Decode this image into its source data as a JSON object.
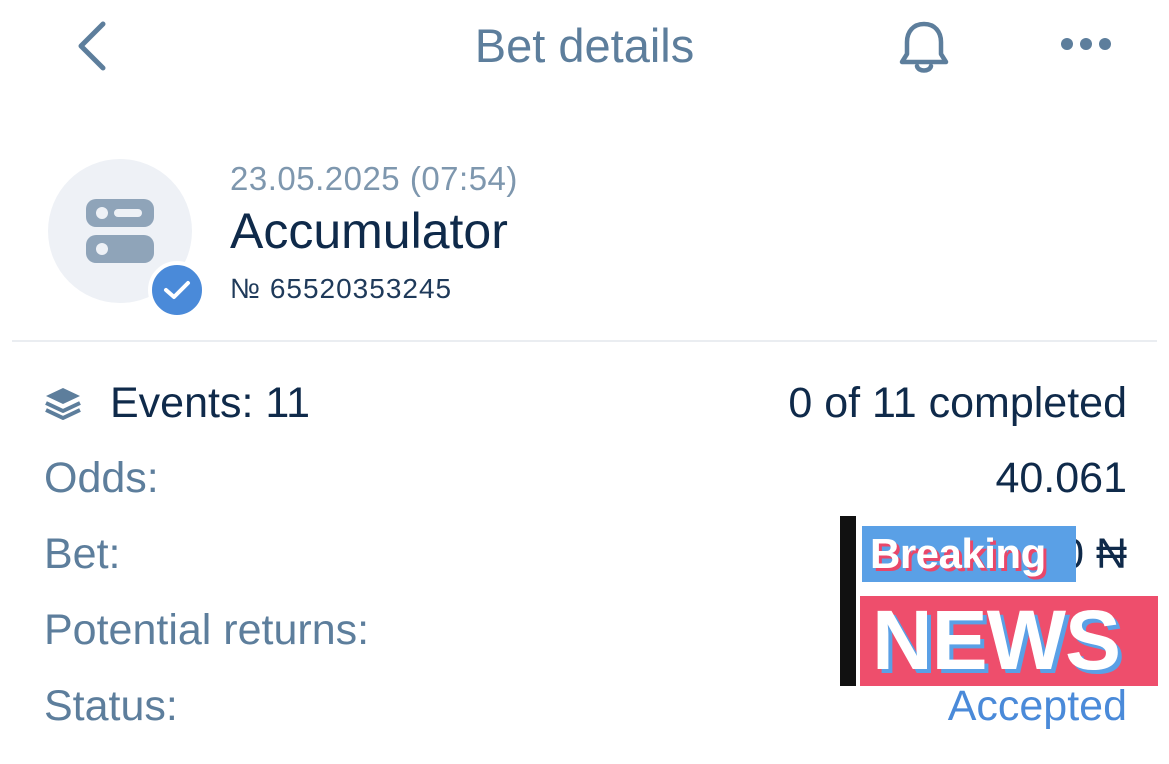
{
  "header": {
    "title": "Bet details",
    "back_icon": "chevron-left-icon",
    "bell_icon": "bell-icon",
    "more_icon": "more-horizontal-icon"
  },
  "bet": {
    "date": "23.05.2025 (07:54)",
    "type": "Accumulator",
    "number": "№ 65520353245",
    "type_icon": "accumulator-list-icon",
    "badge_icon": "checkmark-icon"
  },
  "details": {
    "events_label": "Events: 11",
    "events_icon": "stack-layers-icon",
    "completed": "0 of 11 completed",
    "odds_label": "Odds:",
    "odds_value": "40.061",
    "bet_label": "Bet:",
    "bet_value": "0 ₦",
    "returns_label": "Potential returns:",
    "status_label": "Status:",
    "status_value": "Accepted"
  },
  "overlay": {
    "line1": "Breaking",
    "line2": "NEWS"
  },
  "colors": {
    "accent_blue": "#4a8ad9",
    "status_blue": "#4a8ad9",
    "text_dark": "#0f2a4a",
    "text_muted": "#5d7e9c",
    "news_red": "#ee4e6c",
    "news_blue": "#5aa0e6"
  }
}
